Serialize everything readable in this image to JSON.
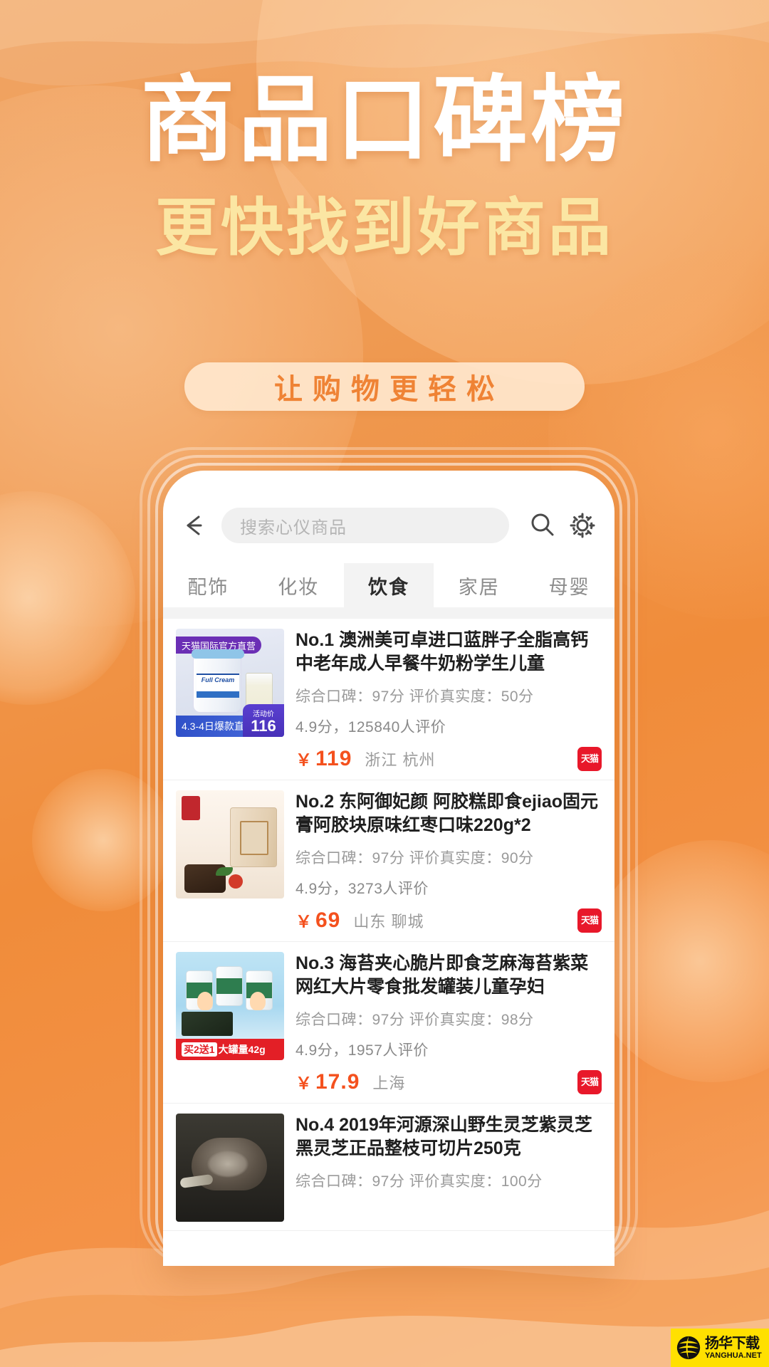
{
  "poster": {
    "headline": "商品口碑榜",
    "subheadline": "更快找到好商品",
    "tagline": "让购物更轻松",
    "colors": {
      "bg_orange": "#f08c3a",
      "headline_white": "#ffffff",
      "subheadline_yellow": "#fbe6a3",
      "pill_bg": "#ffe7cd",
      "pill_text": "#ef8335",
      "price_orange": "#f4511e",
      "shop_badge_red": "#e8182a"
    }
  },
  "app": {
    "topbar": {
      "back_icon": "back-arrow-icon",
      "search_placeholder": "搜索心仪商品",
      "search_icon": "search-icon",
      "settings_icon": "gear-icon"
    },
    "tabs": [
      {
        "label": "配饰",
        "active": false
      },
      {
        "label": "化妆",
        "active": false
      },
      {
        "label": "饮食",
        "active": true
      },
      {
        "label": "家居",
        "active": false
      },
      {
        "label": "母婴",
        "active": false
      }
    ],
    "products": [
      {
        "title": "No.1 澳洲美可卓进口蓝胖子全脂高钙中老年成人早餐牛奶粉学生儿童",
        "score_line": "综合口碑：97分 评价真实度：50分",
        "rating_line": "4.9分，125840人评价",
        "price": "119",
        "currency": "￥",
        "location": "浙江 杭州",
        "shop_badge": "天猫",
        "thumb": {
          "banner": "天猫国际官方直营",
          "jar_label": "Full Cream",
          "ribbon": "4.3-4日爆款直降",
          "promo_label": "活动价",
          "promo_price": "116"
        }
      },
      {
        "title": "No.2 东阿御妃颜 阿胶糕即食ejiao固元膏阿胶块原味红枣口味220g*2",
        "score_line": "综合口碑：97分 评价真实度：90分",
        "rating_line": "4.9分，3273人评价",
        "price": "69",
        "currency": "￥",
        "location": "山东 聊城",
        "shop_badge": "天猫",
        "thumb": {}
      },
      {
        "title": "No.3 海苔夹心脆片即食芝麻海苔紫菜网红大片零食批发罐装儿童孕妇",
        "score_line": "综合口碑：97分 评价真实度：98分",
        "rating_line": "4.9分，1957人评价",
        "price": "17.9",
        "currency": "￥",
        "location": "上海",
        "shop_badge": "天猫",
        "thumb": {
          "promo_1": "买2送1",
          "promo_2": "大罐量",
          "promo_3": "42g"
        }
      },
      {
        "title": "No.4 2019年河源深山野生灵芝紫灵芝黑灵芝正品整枝可切片250克",
        "score_line": "综合口碑：97分 评价真实度：100分",
        "rating_line": "",
        "price": "",
        "currency": "",
        "location": "",
        "shop_badge": "",
        "thumb": {}
      }
    ]
  },
  "watermark": {
    "cn": "扬华下载",
    "en": "YANGHUA.NET"
  }
}
